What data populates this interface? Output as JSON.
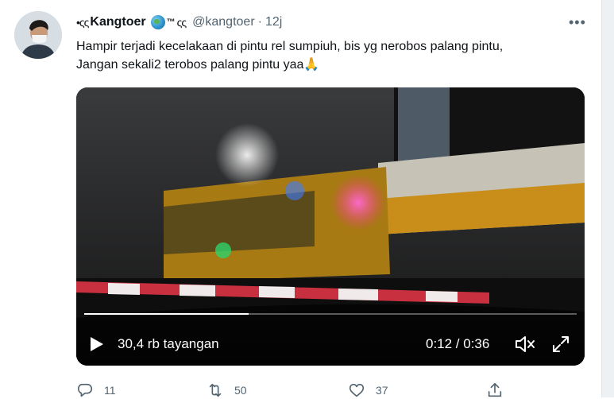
{
  "tweet": {
    "display_name": "Kangtoer",
    "name_prefix": "•ςς",
    "name_suffix": "™",
    "name_trail": "ςς",
    "handle": "@kangtoer",
    "separator": "·",
    "time": "12j",
    "more_label": "•••",
    "text_line1": "Hampir terjadi kecelakaan di pintu rel sumpiuh, bis yg nerobos palang pintu,",
    "text_line2": "Jangan sekali2 terobos palang pintu yaa🙏"
  },
  "video": {
    "views": "30,4 rb tayangan",
    "time_readout": "0:12 / 0:36",
    "progress_fraction": 0.3333
  },
  "actions": {
    "reply_count": "11",
    "retweet_count": "50",
    "like_count": "37"
  },
  "icons": {
    "reply": "reply-icon",
    "retweet": "retweet-icon",
    "like": "like-icon",
    "share": "share-icon",
    "play": "play-icon",
    "mute": "volume-muted-icon",
    "expand": "fullscreen-icon",
    "globe": "globe-emoji-icon"
  },
  "colors": {
    "secondary_text": "#536471",
    "primary_text": "#0f1419"
  }
}
